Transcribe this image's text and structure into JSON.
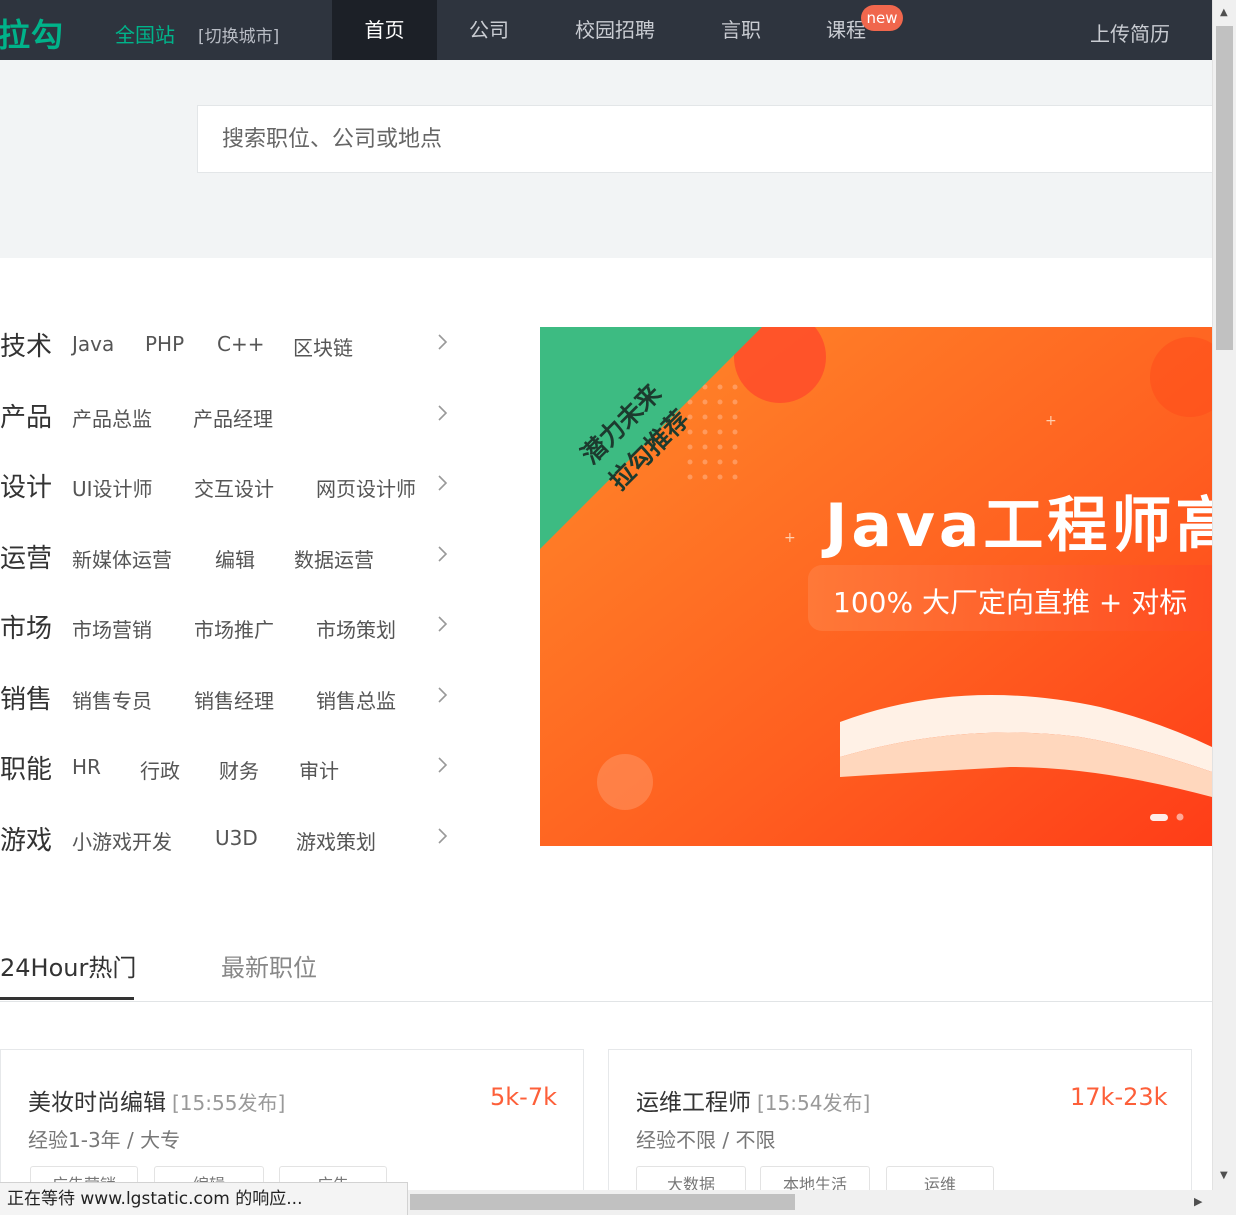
{
  "nav": {
    "logo": "拉勾",
    "city": "全国站",
    "switch_city": "[切换城市]",
    "items": [
      "首页",
      "公司",
      "校园招聘",
      "言职",
      "课程"
    ],
    "new_badge": "new",
    "upload_resume": "上传简历"
  },
  "search": {
    "placeholder": "搜索职位、公司或地点"
  },
  "categories": [
    {
      "title": "技术",
      "links": [
        "Java",
        "PHP",
        "C++",
        "区块链"
      ]
    },
    {
      "title": "产品",
      "links": [
        "产品总监",
        "产品经理"
      ]
    },
    {
      "title": "设计",
      "links": [
        "UI设计师",
        "交互设计",
        "网页设计师"
      ]
    },
    {
      "title": "运营",
      "links": [
        "新媒体运营",
        "编辑",
        "数据运营"
      ]
    },
    {
      "title": "市场",
      "links": [
        "市场营销",
        "市场推广",
        "市场策划"
      ]
    },
    {
      "title": "销售",
      "links": [
        "销售专员",
        "销售经理",
        "销售总监"
      ]
    },
    {
      "title": "职能",
      "links": [
        "HR",
        "行政",
        "财务",
        "审计"
      ]
    },
    {
      "title": "游戏",
      "links": [
        "小游戏开发",
        "U3D",
        "游戏策划"
      ]
    }
  ],
  "banner": {
    "ribbon_line1": "潜力未来",
    "ribbon_line2": "拉勾推荐",
    "headline": "Java工程师高",
    "subline": "100% 大厂定向直推 + 对标"
  },
  "tabs": {
    "hot": "24Hour热门",
    "latest": "最新职位"
  },
  "jobs": [
    {
      "title": "美妆时尚编辑",
      "time": "[15:55发布]",
      "salary": "5k-7k",
      "requirements": "经验1-3年 / 大专",
      "tags": [
        "广告营销",
        "编辑",
        "广告"
      ]
    },
    {
      "title": "运维工程师",
      "time": "[15:54发布]",
      "salary": "17k-23k",
      "requirements": "经验不限 / 不限",
      "tags": [
        "大数据",
        "本地生活",
        "运维"
      ]
    }
  ],
  "status_bar": "正在等待 www.lgstatic.com 的响应...",
  "colors": {
    "brand": "#00b38a",
    "nav_bg": "#2e343e",
    "salary": "#fd5f39",
    "badge": "#f0674d",
    "banner": "#ff5a1f"
  }
}
